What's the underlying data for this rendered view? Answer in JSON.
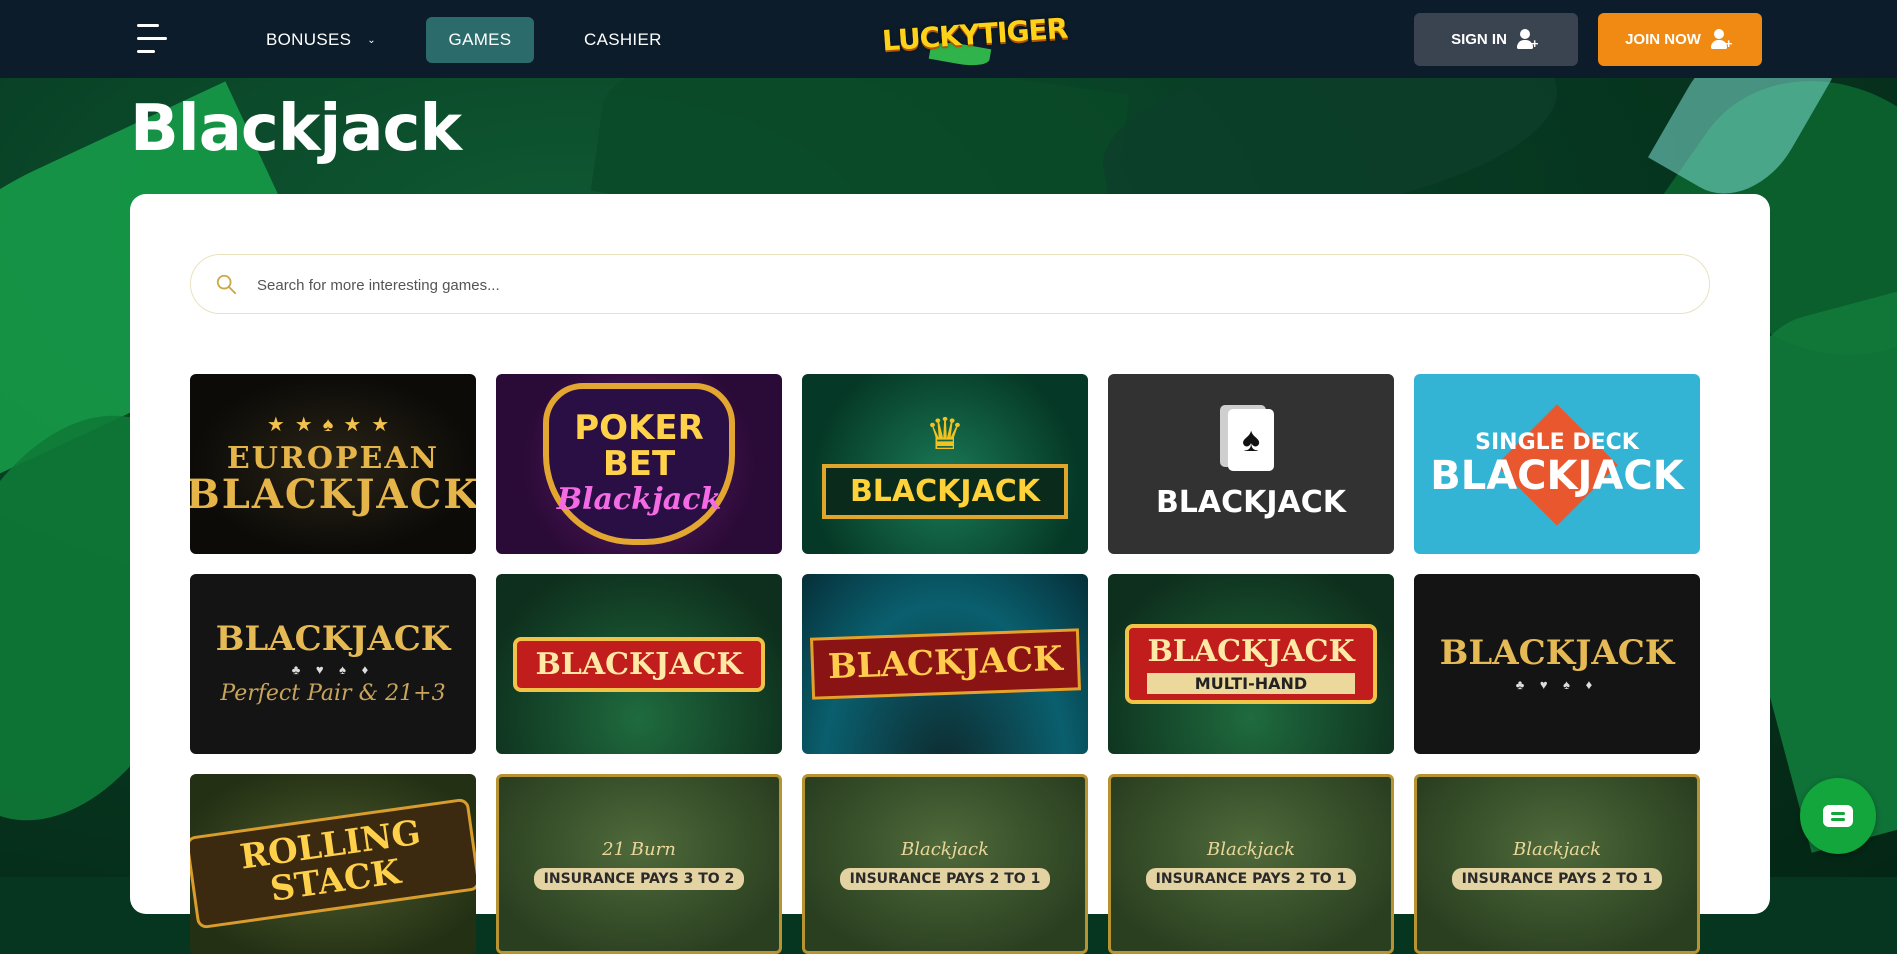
{
  "header": {
    "nav": [
      {
        "label": "BONUSES"
      },
      {
        "label": "GAMES"
      },
      {
        "label": "CASHIER"
      }
    ],
    "logo_text": "LUCKYTIGER",
    "signin_label": "SIGN IN",
    "join_label": "JOIN NOW"
  },
  "page": {
    "title": "Blackjack"
  },
  "search": {
    "placeholder": "Search for more interesting games..."
  },
  "games": [
    {
      "line1": "EUROPEAN",
      "line2": "BLACKJACK"
    },
    {
      "line1": "POKER",
      "line2": "BET",
      "line3": "Blackjack"
    },
    {
      "line1": "BLACKJACK"
    },
    {
      "line1": "BLACKJACK"
    },
    {
      "line1": "SINGLE DECK",
      "line2": "BLACKJACK"
    },
    {
      "line1": "BLACKJACK",
      "line2": "Perfect Pair & 21+3"
    },
    {
      "line1": "BLACKJACK"
    },
    {
      "line1": "BLACKJACK"
    },
    {
      "line1": "BLACKJACK",
      "line2": "MULTI-HAND"
    },
    {
      "line1": "BLACKJACK"
    },
    {
      "line1": "ROLLING STACK"
    },
    {
      "line1": "21 Burn",
      "line2": "INSURANCE PAYS 3 TO 2"
    },
    {
      "line1": "Blackjack",
      "line2": "INSURANCE PAYS 2 TO 1"
    },
    {
      "line1": "Blackjack",
      "line2": "INSURANCE PAYS 2 TO 1"
    },
    {
      "line1": "Blackjack",
      "line2": "INSURANCE PAYS 2 TO 1"
    }
  ],
  "colors": {
    "header_bg": "#0c1c2a",
    "games_active_bg": "#2c6b6b",
    "join_button": "#f08a12",
    "signin_button": "#3a4450",
    "chat_button": "#12a63c"
  },
  "icons": [
    "menu-icon",
    "chevron-down-icon",
    "add-user-icon",
    "search-icon",
    "chat-icon"
  ]
}
